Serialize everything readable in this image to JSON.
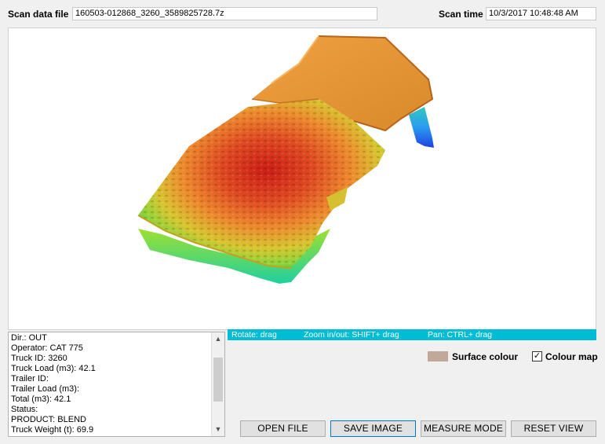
{
  "header": {
    "scan_file_label": "Scan data file",
    "scan_file_value": "160503-012868_3260_3589825728.7z",
    "scan_time_label": "Scan time",
    "scan_time_value": "10/3/2017 10:48:48 AM"
  },
  "info_lines": [
    "Dir.:  OUT",
    "Operator:  CAT 775",
    "Truck ID:  3260",
    "Truck Load (m3):  42.1",
    "Trailer ID:",
    "Trailer Load (m3):",
    "Total (m3):  42.1",
    "Status:",
    "PRODUCT:  BLEND",
    "Truck Weight (t):  69.9"
  ],
  "hints": {
    "rotate": "Rotate: drag",
    "zoom": "Zoom in/out: SHIFT+ drag",
    "pan": "Pan: CTRL+ drag"
  },
  "options": {
    "surface_colour_label": "Surface colour",
    "surface_colour": "#c2a898",
    "colour_map_label": "Colour map",
    "colour_map_checked": true
  },
  "buttons": {
    "open_file": "OPEN FILE",
    "save_image": "SAVE IMAGE",
    "measure_mode": "MEASURE MODE",
    "reset_view": "RESET VIEW"
  },
  "colors": {
    "hint_bar": "#00bcd4",
    "focus_border": "#0078d7"
  }
}
